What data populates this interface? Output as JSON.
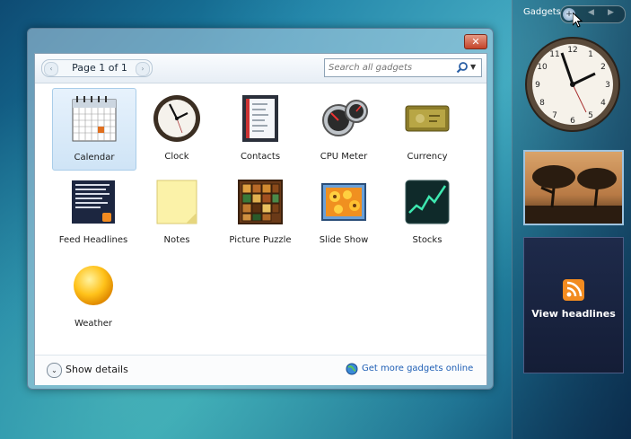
{
  "sidebar": {
    "title": "Gadgets",
    "add_symbol": "+",
    "prev_symbol": "◀",
    "next_symbol": "▶",
    "feed_headline": "View headlines"
  },
  "dialog": {
    "close_symbol": "✕",
    "pager": {
      "label": "Page 1 of 1",
      "prev_symbol": "‹",
      "next_symbol": "›"
    },
    "search": {
      "placeholder": "Search all gadgets",
      "dropdown_symbol": "▼"
    },
    "gadgets": [
      {
        "label": "Calendar",
        "icon": "calendar-icon",
        "selected": true
      },
      {
        "label": "Clock",
        "icon": "clock-icon"
      },
      {
        "label": "Contacts",
        "icon": "contacts-icon"
      },
      {
        "label": "CPU Meter",
        "icon": "cpu-meter-icon"
      },
      {
        "label": "Currency",
        "icon": "currency-icon"
      },
      {
        "label": "Feed Headlines",
        "icon": "feed-headlines-icon"
      },
      {
        "label": "Notes",
        "icon": "notes-icon"
      },
      {
        "label": "Picture Puzzle",
        "icon": "picture-puzzle-icon"
      },
      {
        "label": "Slide Show",
        "icon": "slide-show-icon"
      },
      {
        "label": "Stocks",
        "icon": "stocks-icon"
      },
      {
        "label": "Weather",
        "icon": "weather-icon"
      }
    ],
    "footer": {
      "show_details": "Show details",
      "show_details_symbol": "⌄",
      "more_gadgets": "Get more gadgets online"
    }
  },
  "colors": {
    "accent": "#1f5fb5",
    "close": "#c4442a",
    "rss": "#f28b20"
  }
}
